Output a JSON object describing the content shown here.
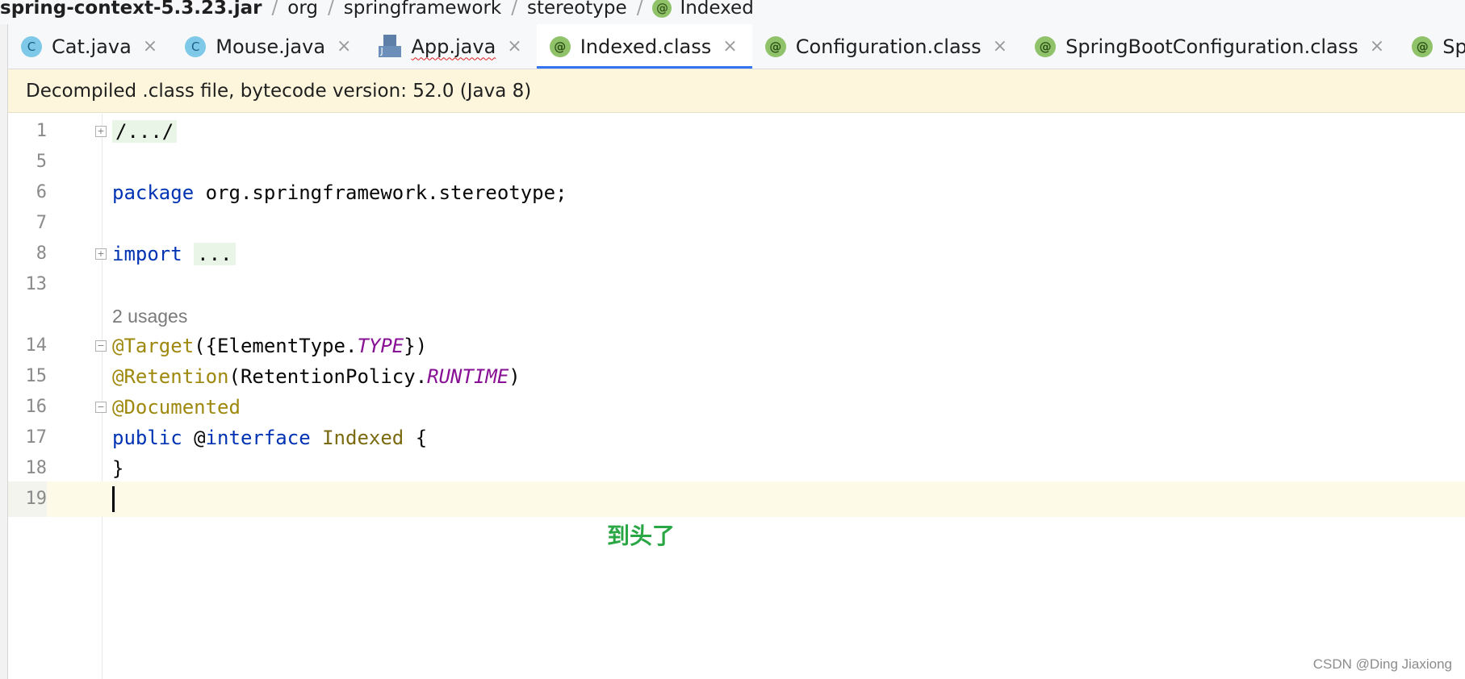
{
  "breadcrumb": {
    "items": [
      "spring-context-5.3.23.jar",
      "org",
      "springframework",
      "stereotype",
      "Indexed"
    ],
    "separator": "/",
    "last_icon": "annotation-icon"
  },
  "tabs": [
    {
      "label": "Cat.java",
      "icon": "class-icon",
      "icon_glyph": "C",
      "closable": true,
      "active": false
    },
    {
      "label": "Mouse.java",
      "icon": "class-icon",
      "icon_glyph": "C",
      "closable": true,
      "active": false
    },
    {
      "label": "App.java",
      "icon": "java-app-icon",
      "icon_glyph": "J",
      "closable": true,
      "active": false,
      "error_underline": true
    },
    {
      "label": "Indexed.class",
      "icon": "annotation-icon",
      "icon_glyph": "@",
      "closable": true,
      "active": true
    },
    {
      "label": "Configuration.class",
      "icon": "annotation-icon",
      "icon_glyph": "@",
      "closable": true,
      "active": false
    },
    {
      "label": "SpringBootConfiguration.class",
      "icon": "annotation-icon",
      "icon_glyph": "@",
      "closable": true,
      "active": false
    },
    {
      "label": "SpringBoo",
      "icon": "annotation-icon",
      "icon_glyph": "@",
      "closable": false,
      "active": false
    }
  ],
  "tab_close_glyph": "×",
  "banner": {
    "text": "Decompiled .class file, bytecode version: 52.0 (Java 8)"
  },
  "editor": {
    "line_numbers": [
      "1",
      "5",
      "6",
      "7",
      "8",
      "13",
      "",
      "14",
      "15",
      "16",
      "17",
      "18",
      "19"
    ],
    "line1_fold": "/.../",
    "line6_keyword": "package",
    "line6_rest": " org.springframework.stereotype;",
    "line8_keyword": "import",
    "line8_fold": "...",
    "usages_hint": "2 usages",
    "line14_ann": "@Target",
    "line14_a": "({ElementType.",
    "line14_const": "TYPE",
    "line14_b": "})",
    "line15_ann": "@Retention",
    "line15_a": "(RetentionPolicy.",
    "line15_const": "RUNTIME",
    "line15_b": ")",
    "line16_ann": "@Documented",
    "line17_kw1": "public",
    "line17_at": " @",
    "line17_kw2": "interface",
    "line17_name": " Indexed",
    "line17_brace": " {",
    "line18": "}",
    "current_line": "19"
  },
  "annotation_note": "到头了",
  "watermark": "CSDN @Ding Jiaxiong",
  "colors": {
    "keyword": "#0033b3",
    "annotation": "#9e880d",
    "constant": "#871094",
    "note": "#29a745",
    "active_tab_underline": "#3574f0",
    "banner_bg": "#fdf6dc"
  }
}
